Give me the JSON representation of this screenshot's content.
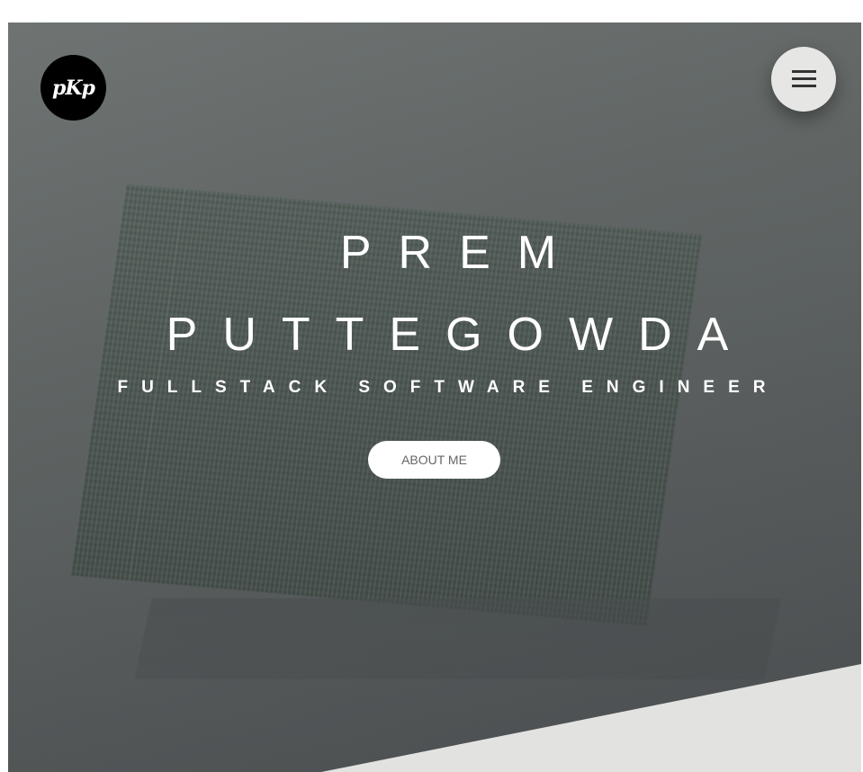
{
  "logo": {
    "text": "pKp"
  },
  "menu": {
    "icon": "hamburger-icon"
  },
  "hero": {
    "first_name": "PREM",
    "last_name": "PUTTEGOWDA",
    "subtitle": "FULLSTACK SOFTWARE ENGINEER",
    "cta_label": "ABOUT ME"
  },
  "colors": {
    "hero_bg": "#5f6463",
    "diagonal_section": "#e2e3e1",
    "menu_button": "#e6e7e5",
    "logo_bg": "#000000",
    "text": "#ffffff"
  }
}
